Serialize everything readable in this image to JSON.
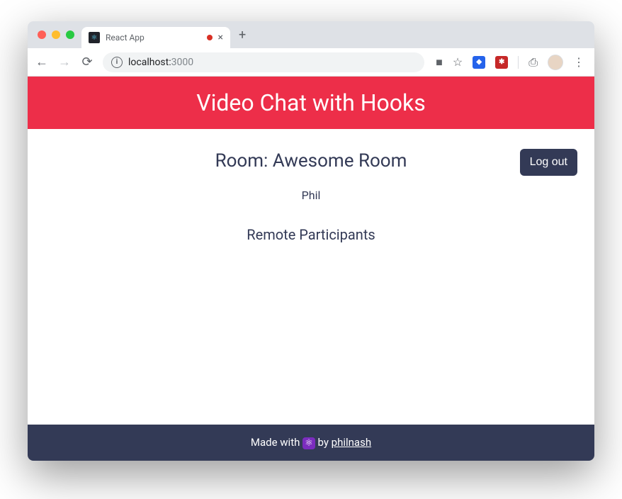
{
  "browser": {
    "tab_title": "React App",
    "url_host": "localhost:",
    "url_port": "3000"
  },
  "header": {
    "title": "Video Chat with Hooks"
  },
  "room": {
    "label_prefix": "Room: ",
    "name": "Awesome Room",
    "logout_label": "Log out"
  },
  "local_participant": {
    "name": "Phil"
  },
  "remote": {
    "heading": "Remote Participants"
  },
  "footer": {
    "made_with": "Made with ",
    "react_icon": "⚛",
    "by": " by ",
    "author": "philnash"
  }
}
